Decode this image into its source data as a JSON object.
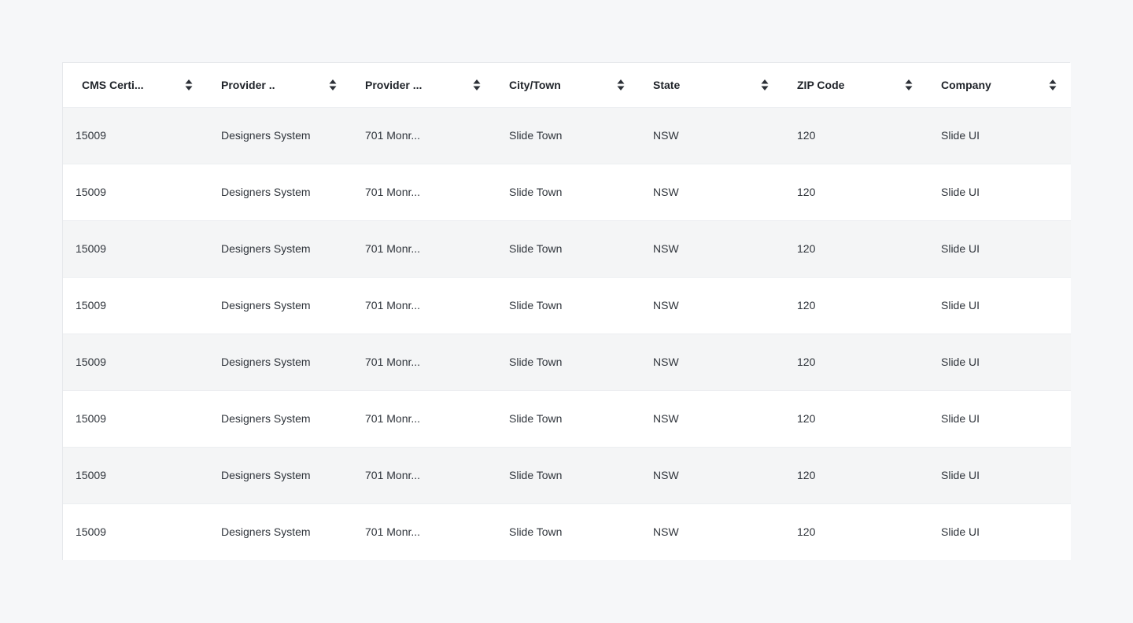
{
  "table": {
    "columns": [
      {
        "label": "CMS Certi..."
      },
      {
        "label": "Provider .."
      },
      {
        "label": "Provider ..."
      },
      {
        "label": "City/Town"
      },
      {
        "label": "State"
      },
      {
        "label": "ZIP Code"
      },
      {
        "label": "Company"
      }
    ],
    "rows": [
      [
        "15009",
        "Designers System",
        "701 Monr...",
        "Slide Town",
        "NSW",
        "120",
        "Slide UI"
      ],
      [
        "15009",
        "Designers System",
        "701 Monr...",
        "Slide Town",
        "NSW",
        "120",
        "Slide UI"
      ],
      [
        "15009",
        "Designers System",
        "701 Monr...",
        "Slide Town",
        "NSW",
        "120",
        "Slide UI"
      ],
      [
        "15009",
        "Designers System",
        "701 Monr...",
        "Slide Town",
        "NSW",
        "120",
        "Slide UI"
      ],
      [
        "15009",
        "Designers System",
        "701 Monr...",
        "Slide Town",
        "NSW",
        "120",
        "Slide UI"
      ],
      [
        "15009",
        "Designers System",
        "701 Monr...",
        "Slide Town",
        "NSW",
        "120",
        "Slide UI"
      ],
      [
        "15009",
        "Designers System",
        "701 Monr...",
        "Slide Town",
        "NSW",
        "120",
        "Slide UI"
      ],
      [
        "15009",
        "Designers System",
        "701 Monr...",
        "Slide Town",
        "NSW",
        "120",
        "Slide UI"
      ]
    ],
    "sort_icon": "sort-updown-icon"
  },
  "colors": {
    "page_background": "#f6f7f9",
    "row_striped": "#f4f5f6",
    "row_plain": "#ffffff",
    "border": "#eceef1",
    "text": "#2f343b"
  }
}
